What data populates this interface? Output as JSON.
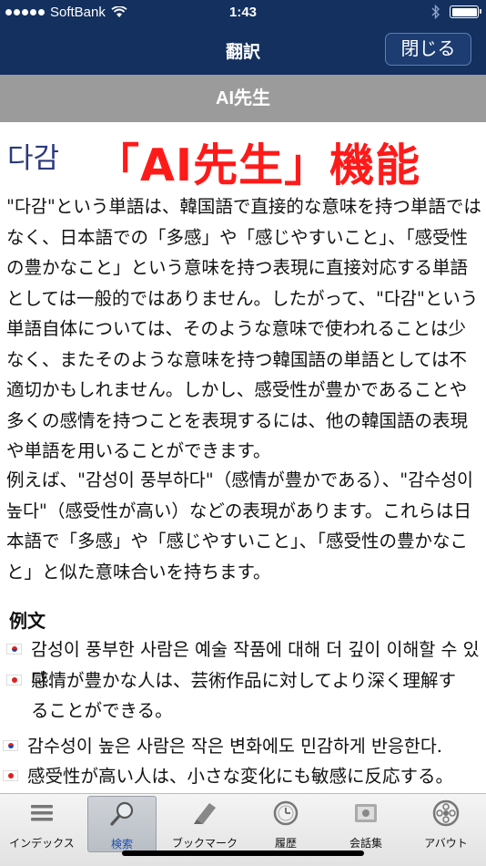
{
  "status_bar": {
    "carrier": "SoftBank",
    "time": "1:43"
  },
  "nav": {
    "title": "翻訳",
    "close_label": "閉じる"
  },
  "section": {
    "title": "AI先生"
  },
  "entry": {
    "headword": "다감",
    "banner": "「AI先生」機能",
    "paragraph1": "\"다감\"という単語は、韓国語で直接的な意味を持つ単語ではなく、日本語での「多感」や「感じやすいこと」、「感受性の豊かなこと」という意味を持つ表現に直接対応する単語としては一般的ではありません。したがって、\"다감\"という単語自体については、そのような意味で使われることは少なく、またそのような意味を持つ韓国語の単語としては不適切かもしれません。しかし、感受性が豊かであることや多くの感情を持つことを表現するには、他の韓国語の表現や単語を用いることができます。",
    "paragraph2": "例えば、\"감성이 풍부하다\"（感情が豊かである）、\"감수성이 높다\"（感受性が高い）などの表現があります。これらは日本語で「多感」や「感じやすいこと」、「感受性の豊かなこと」と似た意味合いを持ちます。",
    "examples_label": "例文",
    "examples": [
      {
        "ko": "감성이 풍부한 사람은 예술 작품에 대해 더 깊이 이해할 수 있다.",
        "ja_line1": "感情が豊かな人は、芸術作品に対してより深く理解す",
        "ja_line2": "ることができる。"
      },
      {
        "ko": "감수성이 높은 사람은 작은 변화에도 민감하게 반응한다.",
        "ja_line1": "感受性が高い人は、小さな変化にも敏感に反応する。"
      }
    ]
  },
  "tabs": [
    {
      "label": "インデックス",
      "icon": "list-icon"
    },
    {
      "label": "検索",
      "icon": "magnifier-icon",
      "active": true
    },
    {
      "label": "ブックマーク",
      "icon": "bookmark-icon"
    },
    {
      "label": "履歴",
      "icon": "clock-icon"
    },
    {
      "label": "会話集",
      "icon": "flag-book-icon"
    },
    {
      "label": "アバウト",
      "icon": "emblem-icon"
    }
  ],
  "colors": {
    "nav_bg": "#13305e",
    "banner_red": "#ff1a1a",
    "headword_blue": "#2c3a7c",
    "section_gray": "#9b9b9b"
  }
}
